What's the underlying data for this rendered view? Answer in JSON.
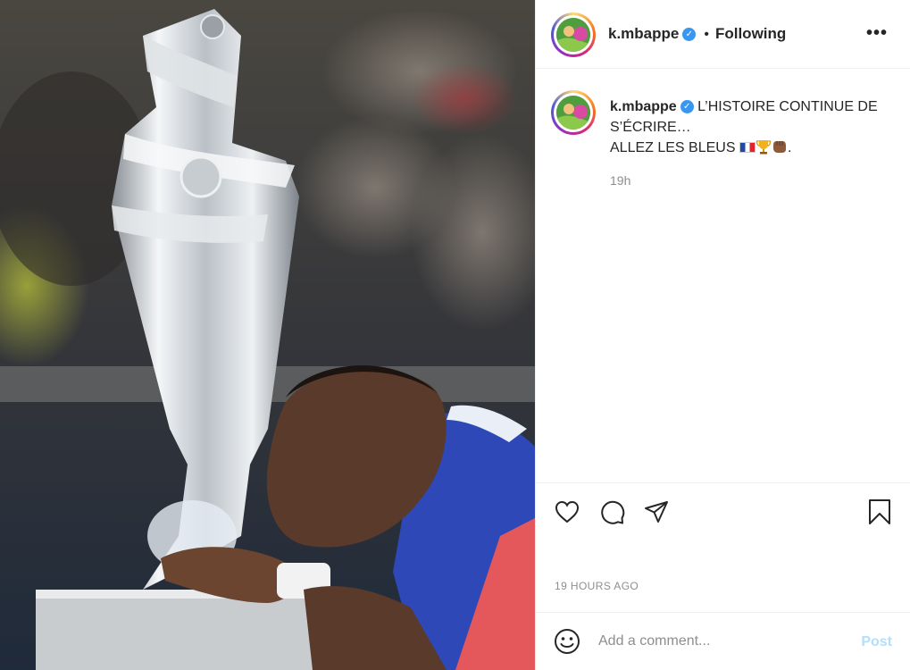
{
  "post": {
    "username": "k.mbappe",
    "verified_mark": "✓",
    "follow_dot": "•",
    "follow_status": "Following",
    "more_label": "•••",
    "caption_line1": "L’HISTOIRE CONTINUE DE S’ÉCRIRE…",
    "caption_line2": "ALLEZ LES BLEUS",
    "caption_end": ".",
    "caption_emojis": [
      "flag-france-icon",
      "trophy-icon",
      "fist-bump-icon"
    ],
    "relative_time": "19h",
    "date_label": "19 HOURS AGO"
  },
  "actions": {
    "icons": [
      "heart-icon",
      "comment-icon",
      "share-icon",
      "bookmark-icon"
    ]
  },
  "comment_box": {
    "placeholder": "Add a comment...",
    "post_label": "Post"
  },
  "colors": {
    "text": "#262626",
    "secondary": "#8e8e8e",
    "verified": "#3897f0",
    "post_disabled": "#b2dffc",
    "divider": "#efefef"
  }
}
